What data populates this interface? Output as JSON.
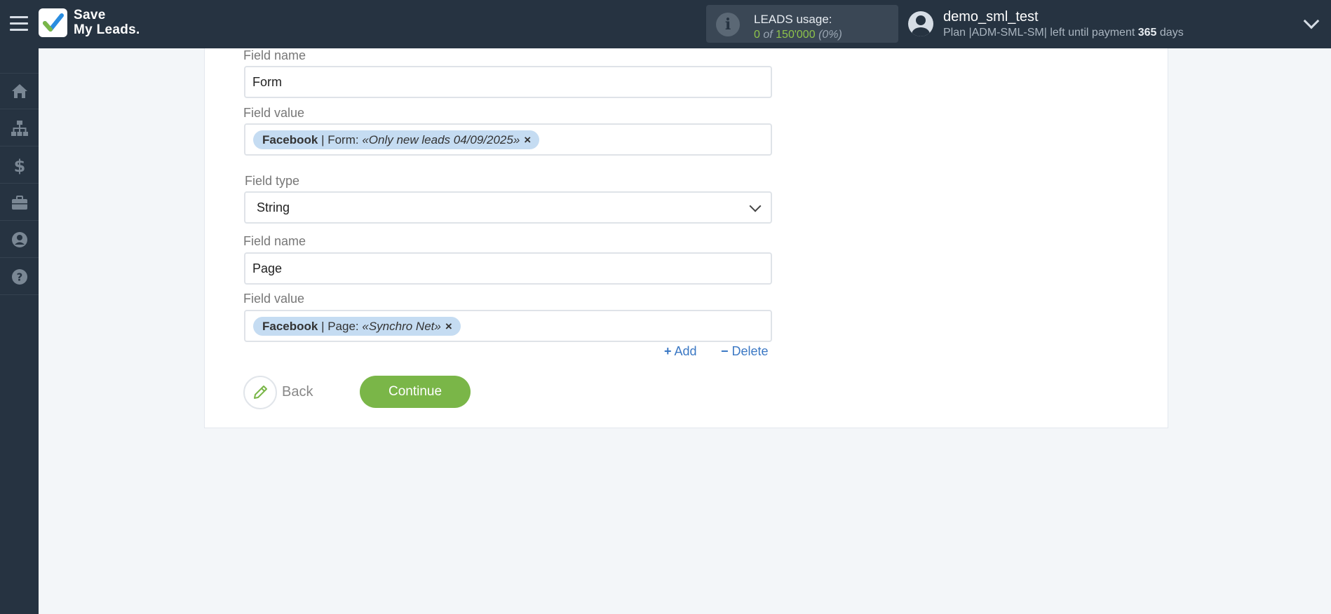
{
  "header": {
    "logo_line1": "Save",
    "logo_line2": "My Leads.",
    "usage_label": "LEADS usage:",
    "usage_used": "0",
    "usage_of": "of",
    "usage_total": "150'000",
    "usage_percent": "(0%)",
    "user_name": "demo_sml_test",
    "plan_prefix": "Plan |ADM-SML-SM| left until payment",
    "plan_days": "365",
    "plan_suffix": "days"
  },
  "sidebar": {
    "items": [
      {
        "icon": "home-icon"
      },
      {
        "icon": "sitemap-icon"
      },
      {
        "icon": "dollar-icon"
      },
      {
        "icon": "briefcase-icon"
      },
      {
        "icon": "user-circle-icon"
      },
      {
        "icon": "help-icon"
      }
    ]
  },
  "form": {
    "field1_name_label": "Field name",
    "field1_name_value": "Form",
    "field1_value_label": "Field value",
    "field1_tag_source": "Facebook",
    "field1_tag_sep": " | Form: ",
    "field1_tag_value": "«Only new leads 04/09/2025»",
    "field2_type_label": "Field type",
    "field2_type_value": "String",
    "field2_name_label": "Field name",
    "field2_name_value": "Page",
    "field2_value_label": "Field value",
    "field2_tag_source": "Facebook",
    "field2_tag_sep": " | Page: ",
    "field2_tag_value": "«Synchro Net»",
    "tag_remove": "×",
    "add_label": "Add",
    "delete_label": "Delete"
  },
  "actions": {
    "back_label": "Back",
    "continue_label": "Continue"
  },
  "colors": {
    "header_bg": "#263341",
    "accent_green": "#7ab648",
    "tag_bg": "#c5dcf2",
    "link_blue": "#3b78c4"
  }
}
